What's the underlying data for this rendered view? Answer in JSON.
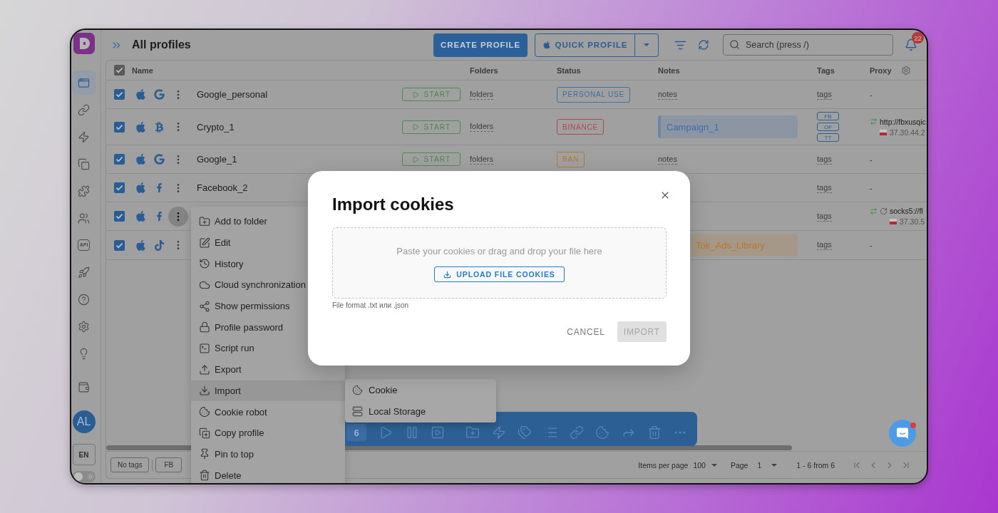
{
  "sidebar": {
    "nav_items": [
      {
        "selected": true
      },
      {
        "selected": false
      },
      {
        "selected": false
      },
      {
        "selected": false
      },
      {
        "selected": false
      },
      {
        "selected": false
      },
      {
        "selected": false,
        "icon_text": "API"
      },
      {
        "selected": false
      },
      {
        "selected": false
      },
      {
        "selected": false
      },
      {
        "selected": false
      }
    ],
    "avatar_initials": "AL",
    "language": "EN",
    "theme_toggle": {
      "on": false
    }
  },
  "header": {
    "title": "All profiles",
    "create_button": "CREATE PROFILE",
    "quick_profile_button": "QUICK PROFILE",
    "search": {
      "placeholder": "Search (press /)"
    },
    "notification_count": "22"
  },
  "table": {
    "select_all": {
      "checked": true
    },
    "columns": [
      {
        "label": "Name"
      },
      {
        "label": "Folders"
      },
      {
        "label": "Status"
      },
      {
        "label": "Notes"
      },
      {
        "label": "Tags"
      },
      {
        "label": "Proxy"
      }
    ],
    "rows": [
      {
        "checked": true,
        "menu_open": false,
        "name": "Google_personal",
        "start_button": "START",
        "folders": "folders",
        "status": {
          "text": "PERSONAL USE",
          "color": "#3c6fa5"
        },
        "notes": {
          "kind": "link",
          "text": "notes"
        },
        "tags": {
          "kind": "link",
          "text": "tags"
        },
        "proxy": {
          "kind": "none",
          "text": "-"
        }
      },
      {
        "checked": true,
        "menu_open": false,
        "name": "Crypto_1",
        "start_button": "START",
        "folders": "folders",
        "status": {
          "text": "BINANCE",
          "color": "#b04848"
        },
        "notes": {
          "kind": "block",
          "text": "Campaign_1",
          "color": "#3d6fa8",
          "clipped": false
        },
        "tags": {
          "kind": "chips",
          "items": [
            "FB",
            "OF",
            "TT"
          ]
        },
        "proxy": {
          "kind": "proxy",
          "url": "http://fbxusqic",
          "ip": "37.30.44.2",
          "checking": false
        }
      },
      {
        "checked": true,
        "menu_open": false,
        "name": "Google_1",
        "start_button": "START",
        "folders": "folders",
        "status": {
          "text": "BAN",
          "color": "#b5782c"
        },
        "notes": {
          "kind": "link",
          "text": "notes"
        },
        "tags": {
          "kind": "link",
          "text": "tags"
        },
        "proxy": {
          "kind": "none",
          "text": "-"
        }
      },
      {
        "checked": true,
        "menu_open": false,
        "name": "Facebook_2",
        "tags": {
          "kind": "link",
          "text": "tags"
        },
        "proxy": {
          "kind": "none",
          "text": "-"
        }
      },
      {
        "checked": true,
        "menu_open": true,
        "tags": {
          "kind": "link",
          "text": "tags"
        },
        "proxy": {
          "kind": "proxy",
          "url": "socks5://fl",
          "ip": "37.30.5",
          "checking": true
        }
      },
      {
        "checked": true,
        "menu_open": false,
        "notes": {
          "kind": "block",
          "text": "Tok_Ads_Library",
          "color": "#b7792a",
          "clipped": true
        },
        "tags": {
          "kind": "link",
          "text": "tags"
        },
        "proxy": {
          "kind": "none",
          "text": "-"
        }
      }
    ]
  },
  "context_menu": {
    "items": [
      {
        "label": "Add to folder",
        "selected": false
      },
      {
        "label": "Edit",
        "selected": false
      },
      {
        "label": "History",
        "selected": false
      },
      {
        "label": "Cloud synchronization",
        "selected": false
      },
      {
        "label": "Show permissions",
        "selected": false
      },
      {
        "label": "Profile password",
        "selected": false
      },
      {
        "label": "Script run",
        "selected": false
      },
      {
        "label": "Export",
        "selected": false
      },
      {
        "label": "Import",
        "selected": true
      },
      {
        "label": "Cookie robot",
        "selected": false
      },
      {
        "label": "Copy profile",
        "selected": false
      },
      {
        "label": "Pin to top",
        "selected": false
      },
      {
        "label": "Delete",
        "selected": false
      }
    ]
  },
  "submenu": {
    "items": [
      {
        "label": "Cookie"
      },
      {
        "label": "Local Storage"
      }
    ]
  },
  "bulk_actions": {
    "selected_count": "6"
  },
  "footer": {
    "tag_filters": [
      {
        "label": "No tags"
      },
      {
        "label": "FB"
      }
    ],
    "items_per_page_label": "Items per page",
    "items_per_page": "100",
    "page_label": "Page",
    "page": "1",
    "range": "1 - 6 from 6"
  },
  "modal": {
    "title": "Import cookies",
    "dropzone_text": "Paste your cookies or drag and drop your file here",
    "upload_button": "UPLOAD FILE COOKIES",
    "hint": "File format .txt или .json",
    "actions": [
      {
        "label": "CANCEL",
        "kind": "text",
        "disabled": false
      },
      {
        "label": "IMPORT",
        "kind": "contained",
        "disabled": true
      }
    ]
  },
  "chat_widget": {
    "unread": true
  }
}
